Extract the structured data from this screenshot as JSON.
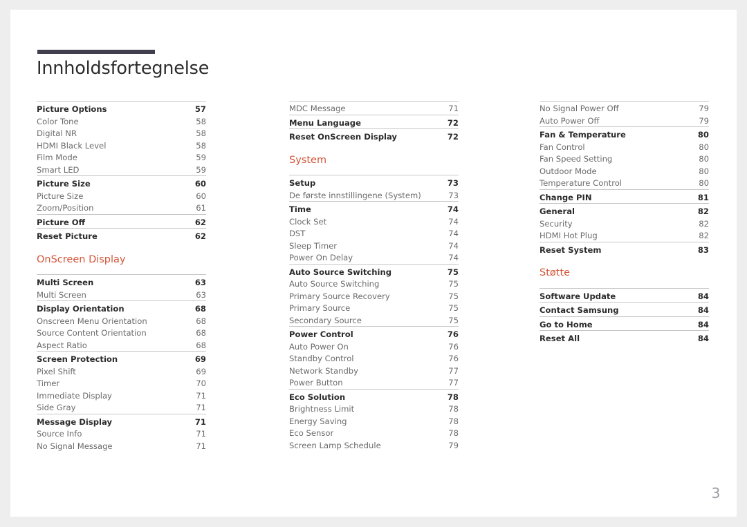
{
  "document": {
    "title": "Innholdsfortegnelse",
    "page_number": "3",
    "accent_color": "#d3563a",
    "rule_color": "#413f4e",
    "divider_color": "#c6c6c6"
  },
  "columns": [
    {
      "blocks": [
        {
          "type": "group",
          "entries": [
            {
              "label": "Picture Options",
              "page": "57",
              "level": "head"
            },
            {
              "label": "Color Tone",
              "page": "58",
              "level": "sub"
            },
            {
              "label": "Digital NR",
              "page": "58",
              "level": "sub"
            },
            {
              "label": "HDMI Black Level",
              "page": "58",
              "level": "sub"
            },
            {
              "label": "Film Mode",
              "page": "59",
              "level": "sub"
            },
            {
              "label": "Smart LED",
              "page": "59",
              "level": "sub"
            }
          ]
        },
        {
          "type": "group",
          "entries": [
            {
              "label": "Picture Size",
              "page": "60",
              "level": "head"
            },
            {
              "label": "Picture Size",
              "page": "60",
              "level": "sub"
            },
            {
              "label": "Zoom/Position",
              "page": "61",
              "level": "sub"
            }
          ]
        },
        {
          "type": "group",
          "entries": [
            {
              "label": "Picture Off",
              "page": "62",
              "level": "head"
            }
          ]
        },
        {
          "type": "group",
          "entries": [
            {
              "label": "Reset Picture",
              "page": "62",
              "level": "head"
            }
          ]
        },
        {
          "type": "section",
          "title": "OnScreen Display"
        },
        {
          "type": "group",
          "entries": [
            {
              "label": "Multi Screen",
              "page": "63",
              "level": "head"
            },
            {
              "label": "Multi Screen",
              "page": "63",
              "level": "sub"
            }
          ]
        },
        {
          "type": "group",
          "entries": [
            {
              "label": "Display Orientation",
              "page": "68",
              "level": "head"
            },
            {
              "label": "Onscreen Menu Orientation",
              "page": "68",
              "level": "sub"
            },
            {
              "label": "Source Content Orientation",
              "page": "68",
              "level": "sub"
            },
            {
              "label": "Aspect Ratio",
              "page": "68",
              "level": "sub"
            }
          ]
        },
        {
          "type": "group",
          "entries": [
            {
              "label": "Screen Protection",
              "page": "69",
              "level": "head"
            },
            {
              "label": "Pixel Shift",
              "page": "69",
              "level": "sub"
            },
            {
              "label": "Timer",
              "page": "70",
              "level": "sub"
            },
            {
              "label": "Immediate Display",
              "page": "71",
              "level": "sub"
            },
            {
              "label": "Side Gray",
              "page": "71",
              "level": "sub"
            }
          ]
        },
        {
          "type": "group",
          "entries": [
            {
              "label": "Message Display",
              "page": "71",
              "level": "head"
            },
            {
              "label": "Source Info",
              "page": "71",
              "level": "sub"
            },
            {
              "label": "No Signal Message",
              "page": "71",
              "level": "sub"
            }
          ]
        }
      ]
    },
    {
      "blocks": [
        {
          "type": "group",
          "entries": [
            {
              "label": "MDC Message",
              "page": "71",
              "level": "sub"
            }
          ]
        },
        {
          "type": "group",
          "entries": [
            {
              "label": "Menu Language",
              "page": "72",
              "level": "head"
            }
          ]
        },
        {
          "type": "group",
          "entries": [
            {
              "label": "Reset OnScreen Display",
              "page": "72",
              "level": "head"
            }
          ]
        },
        {
          "type": "section",
          "title": "System"
        },
        {
          "type": "group",
          "entries": [
            {
              "label": "Setup",
              "page": "73",
              "level": "head"
            },
            {
              "label": "De første innstillingene (System)",
              "page": "73",
              "level": "sub"
            }
          ]
        },
        {
          "type": "group",
          "entries": [
            {
              "label": "Time",
              "page": "74",
              "level": "head"
            },
            {
              "label": "Clock Set",
              "page": "74",
              "level": "sub"
            },
            {
              "label": "DST",
              "page": "74",
              "level": "sub"
            },
            {
              "label": "Sleep Timer",
              "page": "74",
              "level": "sub"
            },
            {
              "label": "Power On Delay",
              "page": "74",
              "level": "sub"
            }
          ]
        },
        {
          "type": "group",
          "entries": [
            {
              "label": "Auto Source Switching",
              "page": "75",
              "level": "head"
            },
            {
              "label": "Auto Source Switching",
              "page": "75",
              "level": "sub"
            },
            {
              "label": "Primary Source Recovery",
              "page": "75",
              "level": "sub"
            },
            {
              "label": "Primary Source",
              "page": "75",
              "level": "sub"
            },
            {
              "label": "Secondary Source",
              "page": "75",
              "level": "sub"
            }
          ]
        },
        {
          "type": "group",
          "entries": [
            {
              "label": "Power Control",
              "page": "76",
              "level": "head"
            },
            {
              "label": "Auto Power On",
              "page": "76",
              "level": "sub"
            },
            {
              "label": "Standby Control",
              "page": "76",
              "level": "sub"
            },
            {
              "label": "Network Standby",
              "page": "77",
              "level": "sub"
            },
            {
              "label": "Power Button",
              "page": "77",
              "level": "sub"
            }
          ]
        },
        {
          "type": "group",
          "entries": [
            {
              "label": "Eco Solution",
              "page": "78",
              "level": "head"
            },
            {
              "label": "Brightness Limit",
              "page": "78",
              "level": "sub"
            },
            {
              "label": "Energy Saving",
              "page": "78",
              "level": "sub"
            },
            {
              "label": "Eco Sensor",
              "page": "78",
              "level": "sub"
            },
            {
              "label": "Screen Lamp Schedule",
              "page": "79",
              "level": "sub"
            }
          ]
        }
      ]
    },
    {
      "blocks": [
        {
          "type": "group",
          "entries": [
            {
              "label": "No Signal Power Off",
              "page": "79",
              "level": "sub"
            },
            {
              "label": "Auto Power Off",
              "page": "79",
              "level": "sub"
            }
          ]
        },
        {
          "type": "group",
          "entries": [
            {
              "label": "Fan & Temperature",
              "page": "80",
              "level": "head"
            },
            {
              "label": "Fan Control",
              "page": "80",
              "level": "sub"
            },
            {
              "label": "Fan Speed Setting",
              "page": "80",
              "level": "sub"
            },
            {
              "label": "Outdoor Mode",
              "page": "80",
              "level": "sub"
            },
            {
              "label": "Temperature Control",
              "page": "80",
              "level": "sub"
            }
          ]
        },
        {
          "type": "group",
          "entries": [
            {
              "label": "Change PIN",
              "page": "81",
              "level": "head"
            }
          ]
        },
        {
          "type": "group",
          "entries": [
            {
              "label": "General",
              "page": "82",
              "level": "head"
            },
            {
              "label": "Security",
              "page": "82",
              "level": "sub"
            },
            {
              "label": "HDMI Hot Plug",
              "page": "82",
              "level": "sub"
            }
          ]
        },
        {
          "type": "group",
          "entries": [
            {
              "label": "Reset System",
              "page": "83",
              "level": "head"
            }
          ]
        },
        {
          "type": "section",
          "title": "Støtte"
        },
        {
          "type": "group",
          "entries": [
            {
              "label": "Software Update",
              "page": "84",
              "level": "head"
            }
          ]
        },
        {
          "type": "group",
          "entries": [
            {
              "label": "Contact Samsung",
              "page": "84",
              "level": "head"
            }
          ]
        },
        {
          "type": "group",
          "entries": [
            {
              "label": "Go to Home",
              "page": "84",
              "level": "head"
            }
          ]
        },
        {
          "type": "group",
          "entries": [
            {
              "label": "Reset All",
              "page": "84",
              "level": "head"
            }
          ]
        }
      ]
    }
  ]
}
